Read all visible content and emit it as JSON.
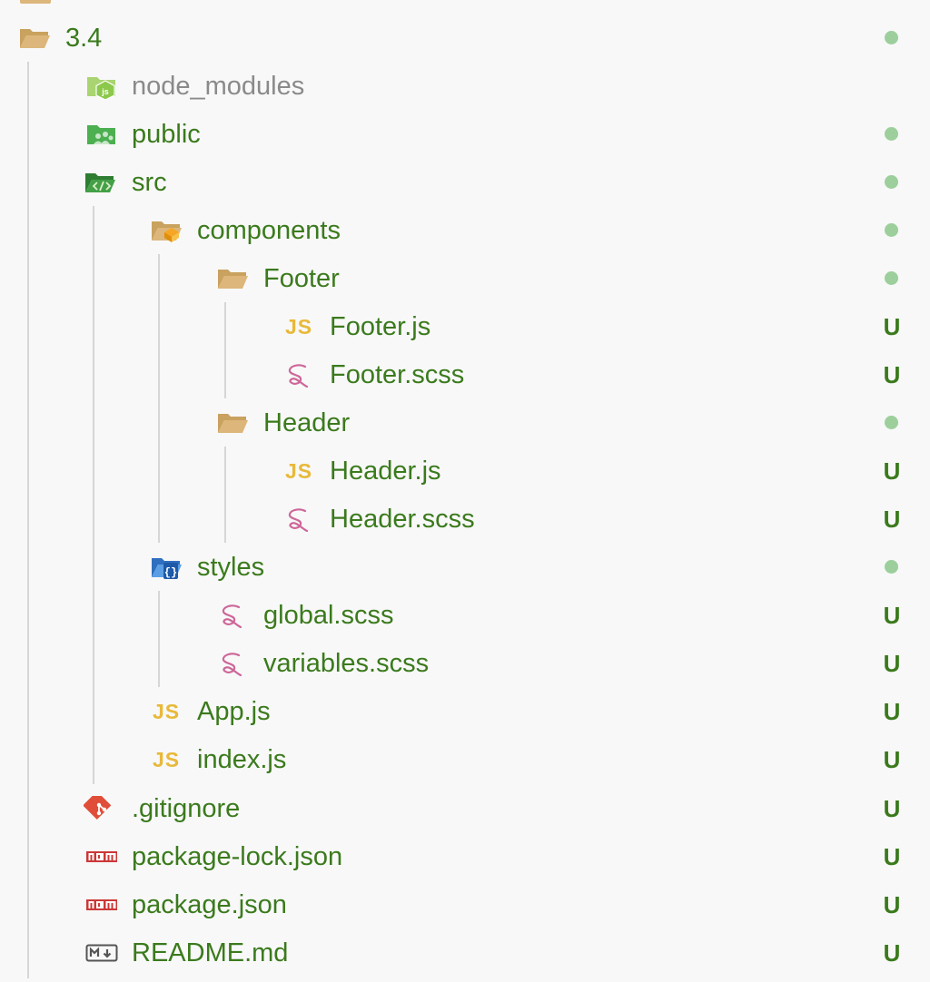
{
  "explorer": {
    "root": {
      "label": "3.4",
      "status": "dot"
    },
    "items": [
      {
        "label": "node_modules",
        "icon": "node-folder-icon",
        "status": ""
      },
      {
        "label": "public",
        "icon": "public-folder-icon",
        "status": "dot"
      },
      {
        "label": "src",
        "icon": "src-folder-icon",
        "status": "dot"
      },
      {
        "label": "components",
        "icon": "components-folder-icon",
        "status": "dot"
      },
      {
        "label": "Footer",
        "icon": "folder-icon",
        "status": "dot"
      },
      {
        "label": "Footer.js",
        "icon": "js-file-icon",
        "status": "U"
      },
      {
        "label": "Footer.scss",
        "icon": "sass-file-icon",
        "status": "U"
      },
      {
        "label": "Header",
        "icon": "folder-icon",
        "status": "dot"
      },
      {
        "label": "Header.js",
        "icon": "js-file-icon",
        "status": "U"
      },
      {
        "label": "Header.scss",
        "icon": "sass-file-icon",
        "status": "U"
      },
      {
        "label": "styles",
        "icon": "styles-folder-icon",
        "status": "dot"
      },
      {
        "label": "global.scss",
        "icon": "sass-file-icon",
        "status": "U"
      },
      {
        "label": "variables.scss",
        "icon": "sass-file-icon",
        "status": "U"
      },
      {
        "label": "App.js",
        "icon": "js-file-icon",
        "status": "U"
      },
      {
        "label": "index.js",
        "icon": "js-file-icon",
        "status": "U"
      },
      {
        "label": ".gitignore",
        "icon": "git-icon",
        "status": "U"
      },
      {
        "label": "package-lock.json",
        "icon": "npm-icon",
        "status": "U"
      },
      {
        "label": "package.json",
        "icon": "npm-icon",
        "status": "U"
      },
      {
        "label": "README.md",
        "icon": "markdown-icon",
        "status": "U"
      }
    ],
    "js_glyph": "JS",
    "colors": {
      "label": "#3b7a1d",
      "ignored_label": "#8a8a8a",
      "untracked": "#3b7a1d",
      "modified_dot": "#9ccf9c",
      "folder": "#dcb67a",
      "js": "#e8b93a",
      "sass": "#cd6799",
      "npm": "#cb3837",
      "git": "#e04e39",
      "node": "#8cc84b",
      "styles": "#3f86d6"
    }
  }
}
